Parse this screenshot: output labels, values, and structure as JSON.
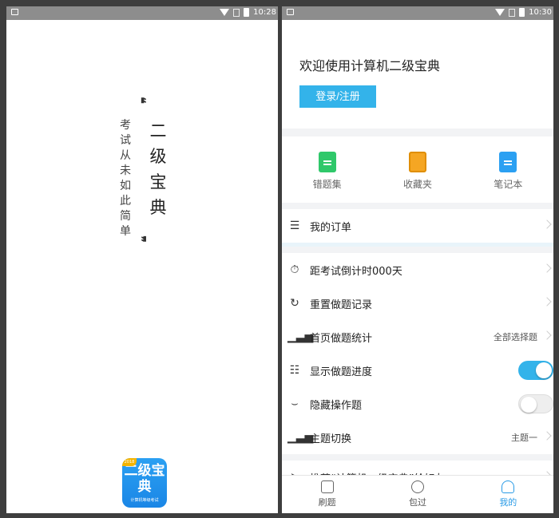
{
  "statusbar": {
    "time": "10:28"
  },
  "statusbar_right": {
    "time": "10:30"
  },
  "splash": {
    "title": "二级宝典",
    "subtitle": "考试从未如此简单",
    "quote_open": "❝",
    "quote_close": "❞",
    "app_icon": {
      "title": "二级宝典",
      "caption": "计算机等级考试",
      "ribbon": "2018"
    }
  },
  "profile": {
    "welcome": "欢迎使用计算机二级宝典",
    "login_label": "登录/注册",
    "shortcuts": [
      {
        "label": "错题集",
        "icon": "wrong-questions-icon"
      },
      {
        "label": "收藏夹",
        "icon": "favorites-icon"
      },
      {
        "label": "笔记本",
        "icon": "notebook-icon"
      }
    ],
    "order": {
      "label": "我的订单",
      "icon": "order-icon"
    },
    "rows": [
      {
        "label": "距考试倒计时000天",
        "icon": "timer-icon"
      },
      {
        "label": "重置做题记录",
        "icon": "reset-icon"
      },
      {
        "label": "首页做题统计",
        "value": "全部选择题",
        "icon": "stats-icon"
      },
      {
        "label": "显示做题进度",
        "icon": "sliders-icon",
        "toggle": "on"
      },
      {
        "label": "隐藏操作题",
        "icon": "eye-closed-icon",
        "toggle": "off"
      },
      {
        "label": "主题切换",
        "value": "主题一",
        "icon": "theme-icon"
      }
    ],
    "recommend": {
      "label": "推荐“计算机二级宝典”给好友",
      "icon": "share-icon"
    }
  },
  "tabbar": {
    "tabs": [
      {
        "label": "刷题",
        "icon": "practice-icon"
      },
      {
        "label": "包过",
        "icon": "planet-icon"
      },
      {
        "label": "我的",
        "icon": "profile-icon",
        "active": true
      }
    ]
  },
  "colors": {
    "accent": "#33b3ea",
    "green": "#2fc86a",
    "orange": "#f5a623",
    "blue": "#2ba0f2"
  }
}
